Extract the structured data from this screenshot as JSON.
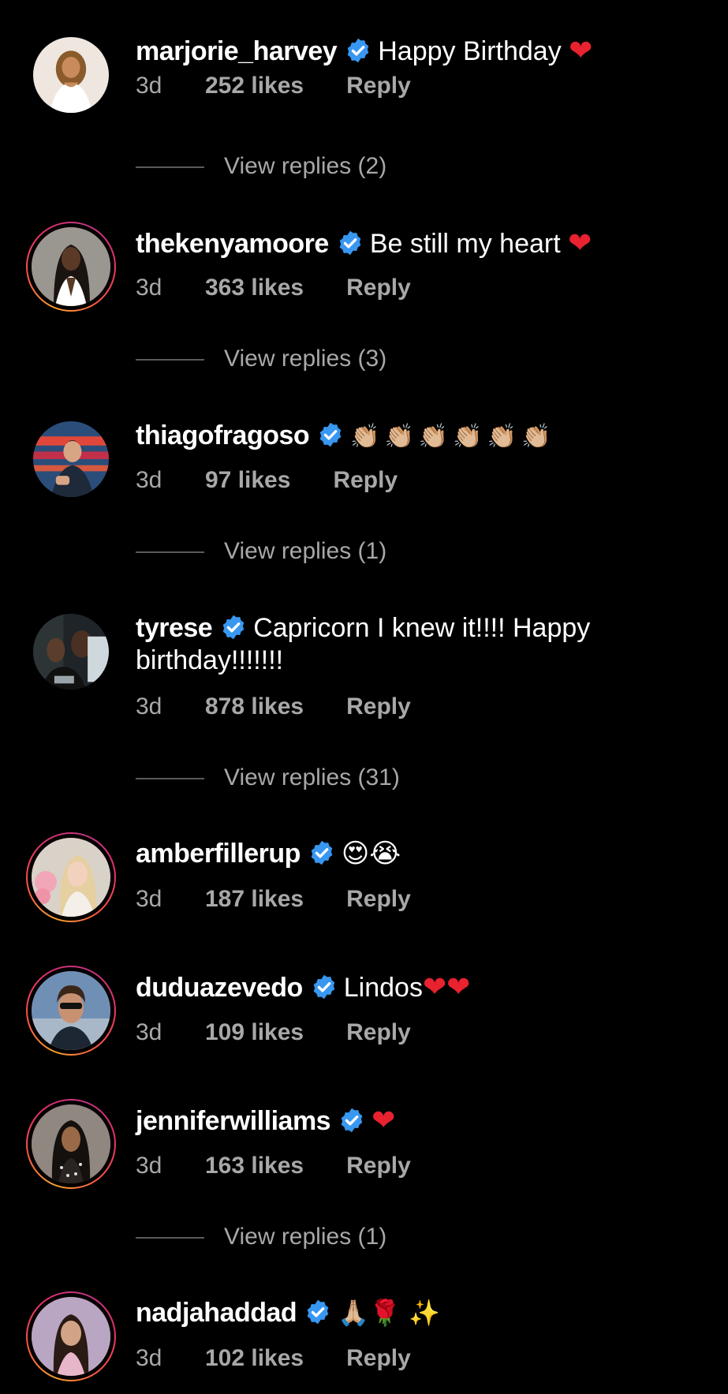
{
  "comments": [
    {
      "username": "marjorie_harvey",
      "text": "Happy Birthday ",
      "emoji": "❤",
      "time": "3d",
      "likes": "252 likes",
      "reply": "Reply",
      "view_replies": "View replies (2)",
      "story_ring": false
    },
    {
      "username": "thekenyamoore",
      "text": "Be still my heart ",
      "emoji": "❤",
      "time": "3d",
      "likes": "363 likes",
      "reply": "Reply",
      "view_replies": "View replies (3)",
      "story_ring": true
    },
    {
      "username": "thiagofragoso",
      "text": "",
      "emoji": "👏🏼👏🏼👏🏼👏🏼👏🏼👏🏼",
      "time": "3d",
      "likes": "97 likes",
      "reply": "Reply",
      "view_replies": "View replies (1)",
      "story_ring": false
    },
    {
      "username": "tyrese",
      "text": "Capricorn I knew it!!!! Happy birthday!!!!!!!",
      "emoji": "",
      "time": "3d",
      "likes": "878 likes",
      "reply": "Reply",
      "view_replies": "View replies (31)",
      "story_ring": false
    },
    {
      "username": "amberfillerup",
      "text": "",
      "emoji": "😍😭",
      "time": "3d",
      "likes": "187 likes",
      "reply": "Reply",
      "story_ring": true
    },
    {
      "username": "duduazevedo",
      "text": "Lindos",
      "emoji": "❤❤",
      "time": "3d",
      "likes": "109 likes",
      "reply": "Reply",
      "story_ring": true
    },
    {
      "username": "jenniferwilliams",
      "text": "",
      "emoji": "❤",
      "time": "3d",
      "likes": "163 likes",
      "reply": "Reply",
      "view_replies": "View replies (1)",
      "story_ring": true
    },
    {
      "username": "nadjahaddad",
      "text": "",
      "emoji": "🙏🏼🌹 ✨",
      "time": "3d",
      "likes": "102 likes",
      "reply": "Reply",
      "story_ring": true
    }
  ],
  "colors": {
    "background": "#000000",
    "primary_text": "#ffffff",
    "secondary_text": "#a8a8a8",
    "verified_badge": "#3897f0",
    "heart": "#e8222f",
    "story_ring_start": "#f9a12e",
    "story_ring_end": "#c13584"
  }
}
